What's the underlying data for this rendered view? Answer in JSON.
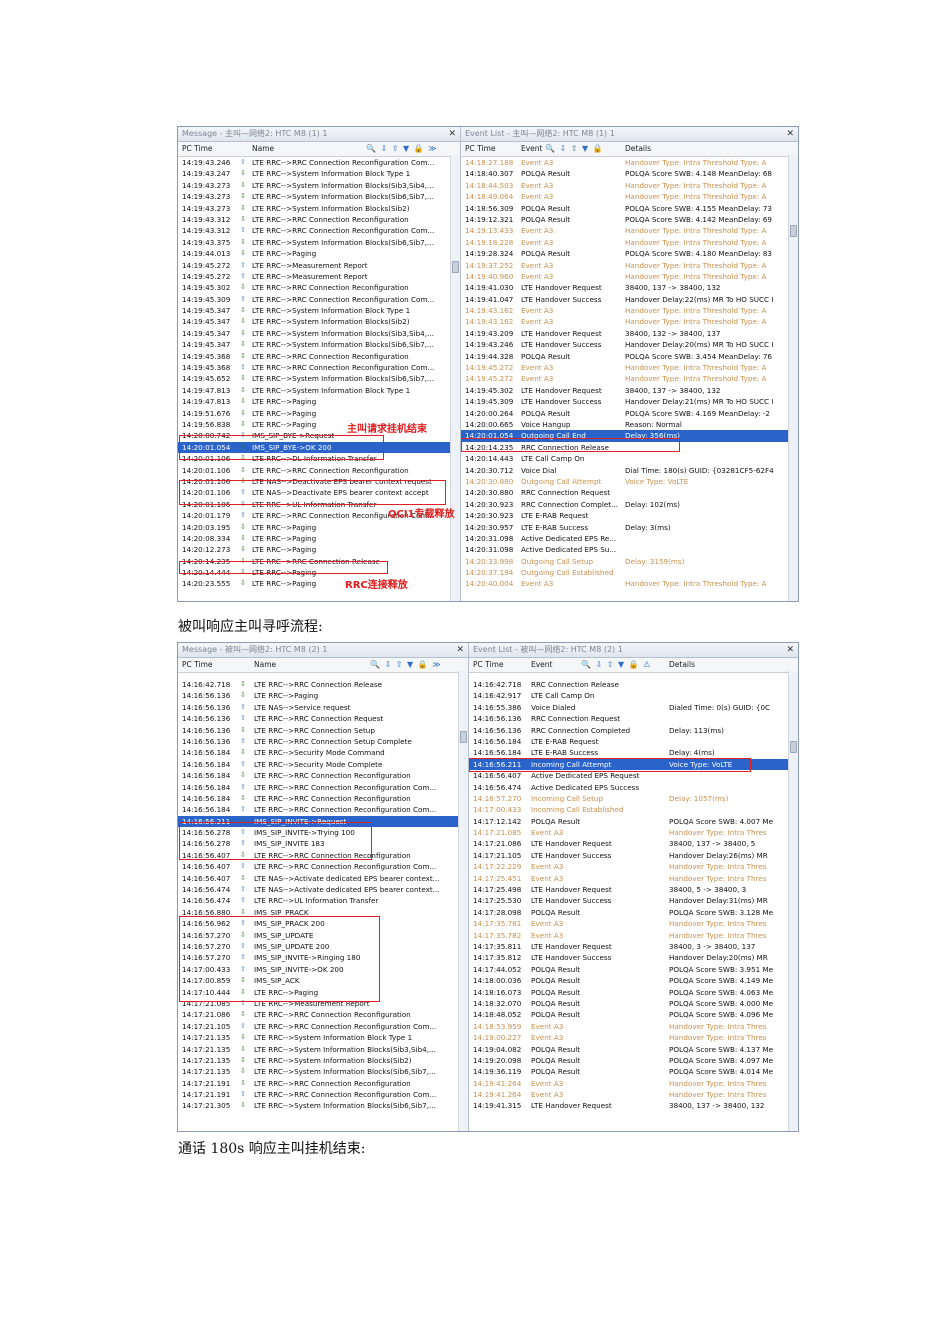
{
  "captions": {
    "c1": "被叫响应主叫寻呼流程:",
    "c2": "通话 180s 响应主叫挂机结束:"
  },
  "s1": {
    "left_title": "Message - 主叫—网络2: HTC M8 (1) 1",
    "right_title": "Event List - 主叫—网络2: HTC M8 (1) 1",
    "left_headers": [
      "PC Time",
      "Name"
    ],
    "right_headers": [
      "PC Time",
      "Event",
      "Details"
    ],
    "msgs": [
      [
        "14:19:43.246",
        "up",
        "LTE RRC-->RRC Connection Reconfiguration Com..."
      ],
      [
        "14:19:43.247",
        "dn",
        "LTE RRC-->System Information Block Type 1"
      ],
      [
        "14:19:43.273",
        "dn",
        "LTE RRC-->System Information Blocks(Sib3,Sib4,..."
      ],
      [
        "14:19:43.273",
        "dn",
        "LTE RRC-->System Information Blocks(Sib6,Sib7,..."
      ],
      [
        "14:19:43.273",
        "dn",
        "LTE RRC-->System Information Blocks(Sib2)"
      ],
      [
        "14:19:43.312",
        "dn",
        "LTE RRC-->RRC Connection Reconfiguration"
      ],
      [
        "14:19:43.312",
        "up",
        "LTE RRC-->RRC Connection Reconfiguration Com..."
      ],
      [
        "14:19:43.375",
        "dn",
        "LTE RRC-->System Information Blocks(Sib6,Sib7,..."
      ],
      [
        "14:19:44.013",
        "dn",
        "LTE RRC-->Paging"
      ],
      [
        "14:19:45.272",
        "up",
        "LTE RRC-->Measurement Report"
      ],
      [
        "14:19:45.272",
        "up",
        "LTE RRC-->Measurement Report"
      ],
      [
        "14:19:45.302",
        "dn",
        "LTE RRC-->RRC Connection Reconfiguration"
      ],
      [
        "14:19:45.309",
        "up",
        "LTE RRC-->RRC Connection Reconfiguration Com..."
      ],
      [
        "14:19:45.347",
        "dn",
        "LTE RRC-->System Information Block Type 1"
      ],
      [
        "14:19:45.347",
        "dn",
        "LTE RRC-->System Information Blocks(Sib2)"
      ],
      [
        "14:19:45.347",
        "dn",
        "LTE RRC-->System Information Blocks(Sib3,Sib4,..."
      ],
      [
        "14:19:45.347",
        "dn",
        "LTE RRC-->System Information Blocks(Sib6,Sib7,..."
      ],
      [
        "14:19:45.368",
        "dn",
        "LTE RRC-->RRC Connection Reconfiguration"
      ],
      [
        "14:19:45.368",
        "up",
        "LTE RRC-->RRC Connection Reconfiguration Com..."
      ],
      [
        "14:19:45.652",
        "dn",
        "LTE RRC-->System Information Blocks(Sib6,Sib7,..."
      ],
      [
        "14:19:47.813",
        "dn",
        "LTE RRC-->System Information Block Type 1"
      ],
      [
        "14:19:47.813",
        "dn",
        "LTE RRC-->Paging"
      ],
      [
        "14:19:51.676",
        "dn",
        "LTE RRC-->Paging"
      ],
      [
        "14:19:56.838",
        "dn",
        "LTE RRC-->Paging"
      ],
      [
        "14:20:00.742",
        "up",
        "IMS_SIP_BYE->Request"
      ],
      [
        "14:20:01.054",
        "dn",
        "IMS_SIP_BYE->OK 200"
      ],
      [
        "14:20:01.106",
        "dn",
        "LTE RRC-->DL Information Transfer"
      ],
      [
        "14:20:01.106",
        "dn",
        "LTE RRC-->RRC Connection Reconfiguration"
      ],
      [
        "14:20:01.106",
        "dn",
        "LTE NAS-->Deactivate EPS bearer context request"
      ],
      [
        "14:20:01.106",
        "up",
        "LTE NAS-->Deactivate EPS bearer context accept"
      ],
      [
        "14:20:01.106",
        "up",
        "LTE RRC-->UL Information Transfer"
      ],
      [
        "14:20:01.179",
        "up",
        "LTE RRC-->RRC Connection Reconfiguration Com..."
      ],
      [
        "14:20:03.195",
        "dn",
        "LTE RRC-->Paging"
      ],
      [
        "14:20:08.334",
        "dn",
        "LTE RRC-->Paging"
      ],
      [
        "14:20:12.273",
        "dn",
        "LTE RRC-->Paging"
      ],
      [
        "14:20:14.235",
        "dn",
        "LTE RRC-->RRC Connection Release"
      ],
      [
        "14:20:14.444",
        "dn",
        "LTE RRC-->Paging"
      ],
      [
        "14:20:23.555",
        "dn",
        "LTE RRC-->Paging"
      ]
    ],
    "events": [
      [
        "14:18:27.188",
        "Event A3",
        "Handover Type: Intra  Threshold Type: A",
        "d"
      ],
      [
        "14:18:40.307",
        "POLQA Result",
        "POLQA Score SWB: 4.148  MeanDelay: 68",
        ""
      ],
      [
        "14:18:44.503",
        "Event A3",
        "Handover Type: Intra  Threshold Type: A",
        "d"
      ],
      [
        "14:18:49.064",
        "Event A3",
        "Handover Type: Intra  Threshold Type: A",
        "d"
      ],
      [
        "14:18:56.309",
        "POLQA Result",
        "POLQA Score SWB: 4.155  MeanDelay: 73",
        ""
      ],
      [
        "14:19:12.321",
        "POLQA Result",
        "POLQA Score SWB: 4.142  MeanDelay: 69",
        ""
      ],
      [
        "14:19:13.433",
        "Event A3",
        "Handover Type: Intra  Threshold Type: A",
        "d"
      ],
      [
        "14:19:18.228",
        "Event A3",
        "Handover Type: Intra  Threshold Type: A",
        "d"
      ],
      [
        "14:19:28.324",
        "POLQA Result",
        "POLQA Score SWB: 4.180  MeanDelay: 83",
        ""
      ],
      [
        "14:19:37.252",
        "Event A3",
        "Handover Type: Intra  Threshold Type: A",
        "d"
      ],
      [
        "14:19:40.960",
        "Event A3",
        "Handover Type: Intra  Threshold Type: A",
        "d"
      ],
      [
        "14:19:41.030",
        "LTE Handover Request",
        "38400, 137 -> 38400, 132",
        ""
      ],
      [
        "14:19:41.047",
        "LTE Handover Success",
        "Handover Delay:22(ms) MR To HO SUCC I",
        ""
      ],
      [
        "14:19:43.162",
        "Event A3",
        "Handover Type: Intra  Threshold Type: A",
        "d"
      ],
      [
        "14:19:43.162",
        "Event A3",
        "Handover Type: Intra  Threshold Type: A",
        "d"
      ],
      [
        "14:19:43.209",
        "LTE Handover Request",
        "38400, 132 -> 38400, 137",
        ""
      ],
      [
        "14:19:43.246",
        "LTE Handover Success",
        "Handover Delay:20(ms) MR To HO SUCC I",
        ""
      ],
      [
        "14:19:44.328",
        "POLQA Result",
        "POLQA Score SWB: 3.454  MeanDelay: 76",
        ""
      ],
      [
        "14:19:45.272",
        "Event A3",
        "Handover Type: Intra  Threshold Type: A",
        "d"
      ],
      [
        "14:19:45.272",
        "Event A3",
        "Handover Type: Intra  Threshold Type: A",
        "d"
      ],
      [
        "14:19:45.302",
        "LTE Handover Request",
        "38400, 137 -> 38400, 132",
        ""
      ],
      [
        "14:19:45.309",
        "LTE Handover Success",
        "Handover Delay:21(ms) MR To HO SUCC I",
        ""
      ],
      [
        "14:20:00.264",
        "POLQA Result",
        "POLQA Score SWB: 4.169  MeanDelay: -2",
        ""
      ],
      [
        "14:20:00.665",
        "Voice Hangup",
        "Reason: Normal",
        ""
      ],
      [
        "14:20:01.054",
        "Outgoing Call End",
        "Delay: 356(ms)",
        "s"
      ],
      [
        "14:20:14.235",
        "RRC Connection Release",
        "",
        ""
      ],
      [
        "14:20:14.443",
        "LTE Call Camp On",
        "",
        ""
      ],
      [
        "14:20:30.712",
        "Voice Dial",
        "Dial Time: 180(s)  GUID: {03281CF5-62F4",
        ""
      ],
      [
        "14:20:30.880",
        "Outgoing Call Attempt",
        "Voice Type: VoLTE",
        "d"
      ],
      [
        "14:20:30.880",
        "RRC Connection Request",
        "",
        ""
      ],
      [
        "14:20:30.923",
        "RRC Connection Complet...",
        "Delay: 102(ms)",
        ""
      ],
      [
        "14:20:30.923",
        "LTE E-RAB Request",
        "",
        ""
      ],
      [
        "14:20:30.957",
        "LTE E-RAB Success",
        "Delay: 3(ms)",
        ""
      ],
      [
        "14:20:31.098",
        "Active Dedicated EPS Re...",
        "",
        ""
      ],
      [
        "14:20:31.098",
        "Active Dedicated EPS Su...",
        "",
        ""
      ],
      [
        "14:20:33.998",
        "Outgoing Call Setup",
        "Delay: 3159(ms)",
        "d"
      ],
      [
        "14:20:37.194",
        "Outgoing Call Established",
        "",
        "d"
      ],
      [
        "14:20:40.004",
        "Event A3",
        "Handover Type: Intra  Threshold Type: A",
        "d"
      ]
    ],
    "annotations": {
      "a1": "主叫请求挂机结束",
      "a2": "QCI1专载释放",
      "a3": "RRC连接释放"
    }
  },
  "s2": {
    "left_title": "Message - 被叫—网络2: HTC M8 (2) 1",
    "right_title": "Event List - 被叫—网络2: HTC M8 (2) 1",
    "left_headers": [
      "PC Time",
      "Name"
    ],
    "right_headers": [
      "PC Time",
      "Event",
      "Details"
    ],
    "msgs": [
      [
        "14:16:42.718",
        "dn",
        "LTE RRC-->RRC Connection Release"
      ],
      [
        "14:16:56.136",
        "dn",
        "LTE RRC-->Paging"
      ],
      [
        "14:16:56.136",
        "up",
        "LTE NAS-->Service request"
      ],
      [
        "14:16:56.136",
        "up",
        "LTE RRC-->RRC Connection Request"
      ],
      [
        "14:16:56.136",
        "dn",
        "LTE RRC-->RRC Connection Setup"
      ],
      [
        "14:16:56.136",
        "up",
        "LTE RRC-->RRC Connection Setup Complete"
      ],
      [
        "14:16:56.184",
        "dn",
        "LTE RRC-->Security Mode Command"
      ],
      [
        "14:16:56.184",
        "up",
        "LTE RRC-->Security Mode Complete"
      ],
      [
        "14:16:56.184",
        "dn",
        "LTE RRC-->RRC Connection Reconfiguration"
      ],
      [
        "14:16:56.184",
        "up",
        "LTE RRC-->RRC Connection Reconfiguration Com..."
      ],
      [
        "14:16:56.184",
        "dn",
        "LTE RRC-->RRC Connection Reconfiguration"
      ],
      [
        "14:16:56.184",
        "up",
        "LTE RRC-->RRC Connection Reconfiguration Com..."
      ],
      [
        "14:16:56.211",
        "dn",
        "IMS_SIP_INVITE->Request"
      ],
      [
        "14:16:56.278",
        "up",
        "IMS_SIP_INVITE->Trying 100"
      ],
      [
        "14:16:56.278",
        "up",
        "IMS_SIP_INVITE 183"
      ],
      [
        "14:16:56.407",
        "dn",
        "LTE RRC-->RRC Connection Reconfiguration"
      ],
      [
        "14:16:56.407",
        "up",
        "LTE RRC-->RRC Connection Reconfiguration Com..."
      ],
      [
        "14:16:56.407",
        "dn",
        "LTE NAS-->Activate dedicated EPS bearer context..."
      ],
      [
        "14:16:56.474",
        "up",
        "LTE NAS-->Activate dedicated EPS bearer context..."
      ],
      [
        "14:16:56.474",
        "up",
        "LTE RRC-->UL Information Transfer"
      ],
      [
        "14:16:56.880",
        "dn",
        "IMS_SIP_PRACK"
      ],
      [
        "14:16:56.962",
        "up",
        "IMS_SIP_PRACK 200"
      ],
      [
        "14:16:57.270",
        "dn",
        "IMS_SIP_UPDATE"
      ],
      [
        "14:16:57.270",
        "up",
        "IMS_SIP_UPDATE 200"
      ],
      [
        "14:16:57.270",
        "up",
        "IMS_SIP_INVITE->Ringing 180"
      ],
      [
        "14:17:00.433",
        "up",
        "IMS_SIP_INVITE->OK 200"
      ],
      [
        "14:17:00.859",
        "dn",
        "IMS_SIP_ACK"
      ],
      [
        "14:17:10.444",
        "dn",
        "LTE RRC-->Paging"
      ],
      [
        "14:17:21.085",
        "up",
        "LTE RRC-->Measurement Report"
      ],
      [
        "14:17:21.086",
        "dn",
        "LTE RRC-->RRC Connection Reconfiguration"
      ],
      [
        "14:17:21.105",
        "up",
        "LTE RRC-->RRC Connection Reconfiguration Com..."
      ],
      [
        "14:17:21.135",
        "dn",
        "LTE RRC-->System Information Block Type 1"
      ],
      [
        "14:17:21.135",
        "dn",
        "LTE RRC-->System Information Blocks(Sib3,Sib4,..."
      ],
      [
        "14:17:21.135",
        "dn",
        "LTE RRC-->System Information Blocks(Sib2)"
      ],
      [
        "14:17:21.135",
        "dn",
        "LTE RRC-->System Information Blocks(Sib6,Sib7,..."
      ],
      [
        "14:17:21.191",
        "dn",
        "LTE RRC-->RRC Connection Reconfiguration"
      ],
      [
        "14:17:21.191",
        "up",
        "LTE RRC-->RRC Connection Reconfiguration Com..."
      ],
      [
        "14:17:21.305",
        "dn",
        "LTE RRC-->System Information Blocks(Sib6,Sib7,..."
      ]
    ],
    "events": [
      [
        "14:16:42.718",
        "RRC Connection Release",
        "",
        ""
      ],
      [
        "14:16:42.917",
        "LTE Call Camp On",
        "",
        ""
      ],
      [
        "14:16:55.386",
        "Voice Dialed",
        "Dialed Time: 0(s)  GUID: {0C",
        ""
      ],
      [
        "14:16:56.136",
        "RRC Connection Request",
        "",
        ""
      ],
      [
        "14:16:56.136",
        "RRC Connection Completed",
        "Delay: 113(ms)",
        ""
      ],
      [
        "14:16:56.184",
        "LTE E-RAB Request",
        "",
        ""
      ],
      [
        "14:16:56.184",
        "LTE E-RAB Success",
        "Delay: 4(ms)",
        ""
      ],
      [
        "14:16:56.211",
        "Incoming Call Attempt",
        "Voice Type: VoLTE",
        "s"
      ],
      [
        "14:16:56.407",
        "Active Dedicated EPS Request",
        "",
        ""
      ],
      [
        "14:16:56.474",
        "Active Dedicated EPS Success",
        "",
        ""
      ],
      [
        "14:16:57.270",
        "Incoming Call Setup",
        "Delay: 1057(ms)",
        "d"
      ],
      [
        "14:17:00.433",
        "Incoming Call Established",
        "",
        "d"
      ],
      [
        "14:17:12.142",
        "POLQA Result",
        "POLQA Score SWB: 4.007  Me",
        ""
      ],
      [
        "14:17:21.085",
        "Event A3",
        "Handover Type: Intra  Thres",
        "d"
      ],
      [
        "14:17:21.086",
        "LTE Handover Request",
        "38400, 137 -> 38400, 5",
        ""
      ],
      [
        "14:17:21.105",
        "LTE Handover Success",
        "Handover Delay:26(ms) MR",
        ""
      ],
      [
        "14:17:22.229",
        "Event A3",
        "Handover Type: Intra  Thres",
        "d"
      ],
      [
        "14:17:25.451",
        "Event A3",
        "Handover Type: Intra  Thres",
        "d"
      ],
      [
        "14:17:25.498",
        "LTE Handover Request",
        "38400, 5 -> 38400, 3",
        ""
      ],
      [
        "14:17:25.530",
        "LTE Handover Success",
        "Handover Delay:31(ms) MR",
        ""
      ],
      [
        "14:17:28.098",
        "POLQA Result",
        "POLQA Score SWB: 3.128  Me",
        ""
      ],
      [
        "14:17:35.781",
        "Event A3",
        "Handover Type: Intra  Thres",
        "d"
      ],
      [
        "14:17:35.782",
        "Event A3",
        "Handover Type: Intra  Thres",
        "d"
      ],
      [
        "14:17:35.811",
        "LTE Handover Request",
        "38400, 3 -> 38400, 137",
        ""
      ],
      [
        "14:17:35.812",
        "LTE Handover Success",
        "Handover Delay:20(ms) MR",
        ""
      ],
      [
        "14:17:44.052",
        "POLQA Result",
        "POLQA Score SWB: 3.951  Me",
        ""
      ],
      [
        "14:18:00.036",
        "POLQA Result",
        "POLQA Score SWB: 4.149  Me",
        ""
      ],
      [
        "14:18:16.073",
        "POLQA Result",
        "POLQA Score SWB: 4.063  Me",
        ""
      ],
      [
        "14:18:32.070",
        "POLQA Result",
        "POLQA Score SWB: 4.000  Me",
        ""
      ],
      [
        "14:18:48.052",
        "POLQA Result",
        "POLQA Score SWB: 4.096  Me",
        ""
      ],
      [
        "14:18:53.959",
        "Event A3",
        "Handover Type: Intra  Thres",
        "d"
      ],
      [
        "14:19:00.227",
        "Event A3",
        "Handover Type: Intra  Thres",
        "d"
      ],
      [
        "14:19:04.082",
        "POLQA Result",
        "POLQA Score SWB: 4.137  Me",
        ""
      ],
      [
        "14:19:20.098",
        "POLQA Result",
        "POLQA Score SWB: 4.097  Me",
        ""
      ],
      [
        "14:19:36.119",
        "POLQA Result",
        "POLQA Score SWB: 4.014  Me",
        ""
      ],
      [
        "14:19:41.264",
        "Event A3",
        "Handover Type: Intra  Thres",
        "d"
      ],
      [
        "14:19:41.264",
        "Event A3",
        "Handover Type: Intra  Thres",
        "d"
      ],
      [
        "14:19:41.315",
        "LTE Handover Request",
        "38400, 137 -> 38400, 132",
        ""
      ]
    ]
  }
}
